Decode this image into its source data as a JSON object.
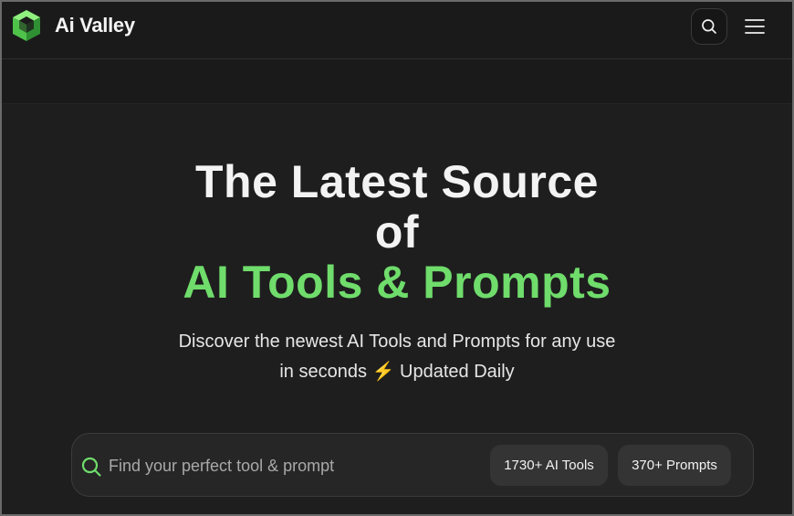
{
  "header": {
    "brand_name": "Ai Valley",
    "logo_icon": "ai-valley-cube-logo-icon",
    "search_icon": "search-icon",
    "menu_icon": "hamburger-menu-icon"
  },
  "hero": {
    "title_line1": "The Latest Source",
    "title_line2": "of",
    "title_accent": "AI Tools & Prompts",
    "subtitle_line1": "Discover the newest AI Tools and Prompts for any use",
    "subtitle_line2_text": "in seconds",
    "subtitle_bolt": "⚡",
    "subtitle_line2_suffix": "Updated Daily"
  },
  "search": {
    "placeholder": "Find your perfect tool & prompt",
    "value": "",
    "icon": "search-icon",
    "tools_count_label": "1730+ AI Tools",
    "prompts_count_label": "370+ Prompts"
  },
  "colors": {
    "accent": "#6fdc6b",
    "background": "#1e1e1e",
    "header_background": "#1a1a1a",
    "pill_background": "#343434"
  }
}
